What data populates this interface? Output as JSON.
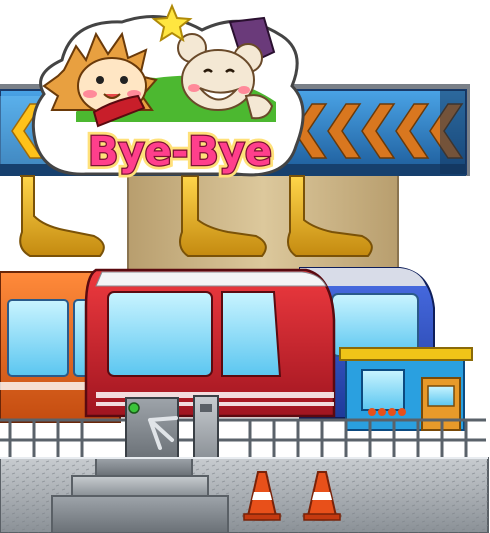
{
  "scene": {
    "sign": {
      "text": "Bye-Bye"
    },
    "palette": {
      "sign_text": "#ff3f8c",
      "sign_text_outline": "#7a1133",
      "sign_text_shadow": "#ffe17a",
      "sign_frame": "#ffffff",
      "banner_left": "#2f7fc4",
      "banner_right": "#1f5e9c",
      "banner_chevron_left": "#ffc21a",
      "banner_chevron_right": "#c86a1e",
      "tower": "#d4bc8c",
      "claw_gold": "#e8b020",
      "car_orange": "#f06a1e",
      "car_red": "#d8262f",
      "car_blue": "#2a52c4",
      "window_blue": "#8fe0ff",
      "booth_blue": "#2aa0e0",
      "booth_roof": "#f0c418",
      "platform_gray": "#9aa0a6",
      "railing": "#6e7780",
      "cone_orange": "#e8501a"
    },
    "elements": [
      "star-icon",
      "hedgehog-mascot",
      "mouse-mascot",
      "bye-bye-sign",
      "chevron-banner",
      "support-tower",
      "claw-arms",
      "orange-car",
      "red-car",
      "blue-car",
      "ticket-booth",
      "turnstile",
      "railing",
      "metal-platform",
      "traffic-cone-left",
      "traffic-cone-right"
    ]
  }
}
